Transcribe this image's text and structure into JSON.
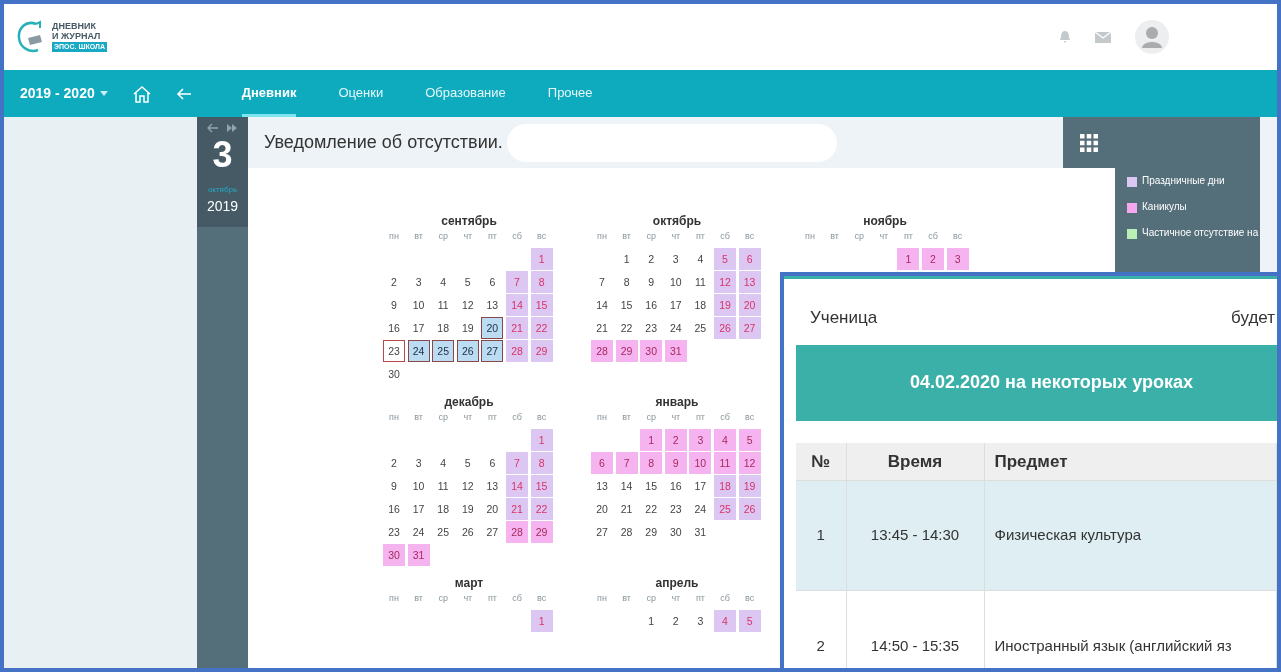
{
  "header": {
    "logo": {
      "lines": [
        "ДНЕВНИК",
        "И ЖУРНАЛ"
      ],
      "badge": "ЭПОС. ШКОЛА"
    }
  },
  "nav": {
    "year": "2019 - 2020",
    "tabs": [
      {
        "label": "Дневник",
        "selected": true
      },
      {
        "label": "Оценки",
        "selected": false
      },
      {
        "label": "Образование",
        "selected": false
      },
      {
        "label": "Прочее",
        "selected": false
      }
    ]
  },
  "date_strip": {
    "day": "3",
    "month": "октябрь",
    "year": "2019"
  },
  "notice": {
    "title": "Уведомление об отсутствии."
  },
  "calendar": {
    "rows": [
      [
        {
          "name": "сентябрь",
          "weekdays": [
            "пн",
            "вт",
            "ср",
            "чт",
            "пт",
            "сб",
            "вс"
          ],
          "weeks": [
            [
              {
                "d": "1",
                "kind": "weekend"
              }
            ],
            [
              {
                "d": "2",
                "kind": "plain"
              },
              {
                "d": "3",
                "kind": "plain"
              },
              {
                "d": "4",
                "kind": "plain"
              },
              {
                "d": "5",
                "kind": "plain"
              },
              {
                "d": "6",
                "kind": "plain"
              },
              {
                "d": "7",
                "kind": "weekend"
              },
              {
                "d": "8",
                "kind": "weekend"
              }
            ],
            [
              {
                "d": "9",
                "kind": "plain"
              },
              {
                "d": "10",
                "kind": "plain"
              },
              {
                "d": "11",
                "kind": "plain"
              },
              {
                "d": "12",
                "kind": "plain"
              },
              {
                "d": "13",
                "kind": "plain"
              },
              {
                "d": "14",
                "kind": "weekend"
              },
              {
                "d": "15",
                "kind": "weekend"
              }
            ],
            [
              {
                "d": "16",
                "kind": "plain"
              },
              {
                "d": "17",
                "kind": "plain"
              },
              {
                "d": "18",
                "kind": "plain"
              },
              {
                "d": "19",
                "kind": "plain"
              },
              {
                "d": "20",
                "kind": "absent"
              },
              {
                "d": "21",
                "kind": "weekend"
              },
              {
                "d": "22",
                "kind": "weekend"
              }
            ],
            [
              {
                "d": "23",
                "kind": "marked"
              },
              {
                "d": "24",
                "kind": "absent"
              },
              {
                "d": "25",
                "kind": "absent"
              },
              {
                "d": "26",
                "kind": "absent"
              },
              {
                "d": "27",
                "kind": "absent"
              },
              {
                "d": "28",
                "kind": "weekend"
              },
              {
                "d": "29",
                "kind": "weekend"
              }
            ],
            [
              {
                "d": "30",
                "kind": "plain"
              }
            ]
          ]
        },
        {
          "name": "октябрь",
          "weekdays": [
            "пн",
            "вт",
            "ср",
            "чт",
            "пт",
            "сб",
            "вс"
          ],
          "weeks": [
            [
              {
                "d": "1",
                "kind": "plain"
              },
              {
                "d": "2",
                "kind": "plain"
              },
              {
                "d": "3",
                "kind": "plain"
              },
              {
                "d": "4",
                "kind": "plain"
              },
              {
                "d": "5",
                "kind": "weekend"
              },
              {
                "d": "6",
                "kind": "weekend"
              }
            ],
            [
              {
                "d": "7",
                "kind": "plain"
              },
              {
                "d": "8",
                "kind": "plain"
              },
              {
                "d": "9",
                "kind": "plain"
              },
              {
                "d": "10",
                "kind": "plain"
              },
              {
                "d": "11",
                "kind": "plain"
              },
              {
                "d": "12",
                "kind": "weekend"
              },
              {
                "d": "13",
                "kind": "weekend"
              }
            ],
            [
              {
                "d": "14",
                "kind": "plain"
              },
              {
                "d": "15",
                "kind": "plain"
              },
              {
                "d": "16",
                "kind": "plain"
              },
              {
                "d": "17",
                "kind": "plain"
              },
              {
                "d": "18",
                "kind": "plain"
              },
              {
                "d": "19",
                "kind": "weekend"
              },
              {
                "d": "20",
                "kind": "weekend"
              }
            ],
            [
              {
                "d": "21",
                "kind": "plain"
              },
              {
                "d": "22",
                "kind": "plain"
              },
              {
                "d": "23",
                "kind": "plain"
              },
              {
                "d": "24",
                "kind": "plain"
              },
              {
                "d": "25",
                "kind": "plain"
              },
              {
                "d": "26",
                "kind": "weekend"
              },
              {
                "d": "27",
                "kind": "weekend"
              }
            ],
            [
              {
                "d": "28",
                "kind": "vacation"
              },
              {
                "d": "29",
                "kind": "vacation"
              },
              {
                "d": "30",
                "kind": "vacation"
              },
              {
                "d": "31",
                "kind": "vacation"
              }
            ]
          ]
        },
        {
          "name": "ноябрь",
          "weekdays": [
            "пн",
            "вт",
            "ср",
            "чт",
            "пт",
            "сб",
            "вс"
          ],
          "weeks": [
            [
              {
                "d": "1",
                "kind": "vacation"
              },
              {
                "d": "2",
                "kind": "vacation"
              },
              {
                "d": "3",
                "kind": "vacation"
              }
            ]
          ]
        }
      ],
      [
        {
          "name": "декабрь",
          "weekdays": [
            "пн",
            "вт",
            "ср",
            "чт",
            "пт",
            "сб",
            "вс"
          ],
          "weeks": [
            [
              {
                "d": "1",
                "kind": "weekend"
              }
            ],
            [
              {
                "d": "2",
                "kind": "plain"
              },
              {
                "d": "3",
                "kind": "plain"
              },
              {
                "d": "4",
                "kind": "plain"
              },
              {
                "d": "5",
                "kind": "plain"
              },
              {
                "d": "6",
                "kind": "plain"
              },
              {
                "d": "7",
                "kind": "weekend"
              },
              {
                "d": "8",
                "kind": "weekend"
              }
            ],
            [
              {
                "d": "9",
                "kind": "plain"
              },
              {
                "d": "10",
                "kind": "plain"
              },
              {
                "d": "11",
                "kind": "plain"
              },
              {
                "d": "12",
                "kind": "plain"
              },
              {
                "d": "13",
                "kind": "plain"
              },
              {
                "d": "14",
                "kind": "weekend"
              },
              {
                "d": "15",
                "kind": "weekend"
              }
            ],
            [
              {
                "d": "16",
                "kind": "plain"
              },
              {
                "d": "17",
                "kind": "plain"
              },
              {
                "d": "18",
                "kind": "plain"
              },
              {
                "d": "19",
                "kind": "plain"
              },
              {
                "d": "20",
                "kind": "plain"
              },
              {
                "d": "21",
                "kind": "weekend"
              },
              {
                "d": "22",
                "kind": "weekend"
              }
            ],
            [
              {
                "d": "23",
                "kind": "plain"
              },
              {
                "d": "24",
                "kind": "plain"
              },
              {
                "d": "25",
                "kind": "plain"
              },
              {
                "d": "26",
                "kind": "plain"
              },
              {
                "d": "27",
                "kind": "plain"
              },
              {
                "d": "28",
                "kind": "vacation"
              },
              {
                "d": "29",
                "kind": "vacation"
              }
            ],
            [
              {
                "d": "30",
                "kind": "vacation"
              },
              {
                "d": "31",
                "kind": "vacation"
              }
            ]
          ]
        },
        {
          "name": "январь",
          "weekdays": [
            "пн",
            "вт",
            "ср",
            "чт",
            "пт",
            "сб",
            "вс"
          ],
          "weeks": [
            [
              {
                "d": "1",
                "kind": "vacation"
              },
              {
                "d": "2",
                "kind": "vacation"
              },
              {
                "d": "3",
                "kind": "vacation"
              },
              {
                "d": "4",
                "kind": "vacation"
              },
              {
                "d": "5",
                "kind": "vacation"
              }
            ],
            [
              {
                "d": "6",
                "kind": "vacation"
              },
              {
                "d": "7",
                "kind": "vacation"
              },
              {
                "d": "8",
                "kind": "vacation"
              },
              {
                "d": "9",
                "kind": "vacation"
              },
              {
                "d": "10",
                "kind": "vacation"
              },
              {
                "d": "11",
                "kind": "vacation"
              },
              {
                "d": "12",
                "kind": "vacation"
              }
            ],
            [
              {
                "d": "13",
                "kind": "plain"
              },
              {
                "d": "14",
                "kind": "plain"
              },
              {
                "d": "15",
                "kind": "plain"
              },
              {
                "d": "16",
                "kind": "plain"
              },
              {
                "d": "17",
                "kind": "plain"
              },
              {
                "d": "18",
                "kind": "weekend"
              },
              {
                "d": "19",
                "kind": "weekend"
              }
            ],
            [
              {
                "d": "20",
                "kind": "plain"
              },
              {
                "d": "21",
                "kind": "plain"
              },
              {
                "d": "22",
                "kind": "plain"
              },
              {
                "d": "23",
                "kind": "plain"
              },
              {
                "d": "24",
                "kind": "plain"
              },
              {
                "d": "25",
                "kind": "weekend"
              },
              {
                "d": "26",
                "kind": "weekend"
              }
            ],
            [
              {
                "d": "27",
                "kind": "plain"
              },
              {
                "d": "28",
                "kind": "plain"
              },
              {
                "d": "29",
                "kind": "plain"
              },
              {
                "d": "30",
                "kind": "plain"
              },
              {
                "d": "31",
                "kind": "plain"
              }
            ]
          ]
        }
      ],
      [
        {
          "name": "март",
          "weekdays": [
            "пн",
            "вт",
            "ср",
            "чт",
            "пт",
            "сб",
            "вс"
          ],
          "weeks": [
            [
              {
                "d": "1",
                "kind": "weekend"
              }
            ]
          ]
        },
        {
          "name": "апрель",
          "weekdays": [
            "пн",
            "вт",
            "ср",
            "чт",
            "пт",
            "сб",
            "вс"
          ],
          "weeks": [
            [
              {
                "d": "1",
                "kind": "plain"
              },
              {
                "d": "2",
                "kind": "plain"
              },
              {
                "d": "3",
                "kind": "plain"
              },
              {
                "d": "4",
                "kind": "weekend"
              },
              {
                "d": "5",
                "kind": "weekend"
              }
            ]
          ]
        }
      ]
    ]
  },
  "legend": [
    {
      "label": "Праздничные дни",
      "color": "#dcc6f2"
    },
    {
      "label": "Каникулы",
      "color": "#f5a8ee"
    },
    {
      "label": "Частичное отсутствие на",
      "color": "#b9efb4"
    }
  ],
  "popup": {
    "student_label": "Ученица",
    "status": "будет",
    "banner": "04.02.2020 на некоторых уроках",
    "columns": [
      "№",
      "Время",
      "Предмет"
    ],
    "rows": [
      {
        "cells": [
          "1",
          "13:45 - 14:30",
          "Физическая культура"
        ],
        "highlighted": true
      },
      {
        "cells": [
          "2",
          "14:50 - 15:35",
          "Иностранный язык (английский яз"
        ],
        "highlighted": false
      }
    ]
  }
}
